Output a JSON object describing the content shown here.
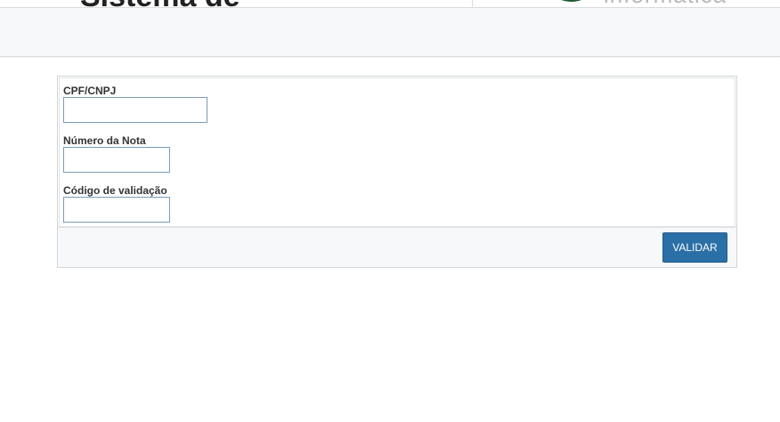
{
  "header": {
    "site_title": "Sistema de",
    "logo_text": "informática"
  },
  "form": {
    "fields": [
      {
        "label": "CPF/CNPJ",
        "value": "",
        "placeholder": ""
      },
      {
        "label": "Número da Nota",
        "value": "",
        "placeholder": ""
      },
      {
        "label": "Código de validação",
        "value": "",
        "placeholder": ""
      }
    ],
    "submit_label": "VALIDAR"
  },
  "colors": {
    "primary_button": "#2a6fa6",
    "input_border": "#7a9cb8",
    "logo_green": "#1e5a2e"
  },
  "icons": {
    "logo": "swoosh-logo-icon"
  }
}
